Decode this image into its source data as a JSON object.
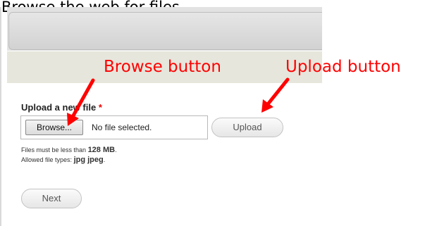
{
  "top_caption": "Browse the web for files",
  "annotations": {
    "browse_label": "Browse button",
    "upload_label": "Upload button"
  },
  "form": {
    "label": "Upload a new file",
    "required_marker": "*",
    "browse_label": "Browse...",
    "file_status": "No file selected.",
    "upload_label": "Upload",
    "help_size_prefix": "Files must be less than",
    "help_size_value": "128 MB",
    "help_size_suffix": ".",
    "help_types_prefix": "Allowed file types:",
    "help_types_value": "jpg jpeg",
    "help_types_suffix": ".",
    "next_label": "Next"
  },
  "colors": {
    "annotation": "#ff0000",
    "required": "#ee0000"
  }
}
